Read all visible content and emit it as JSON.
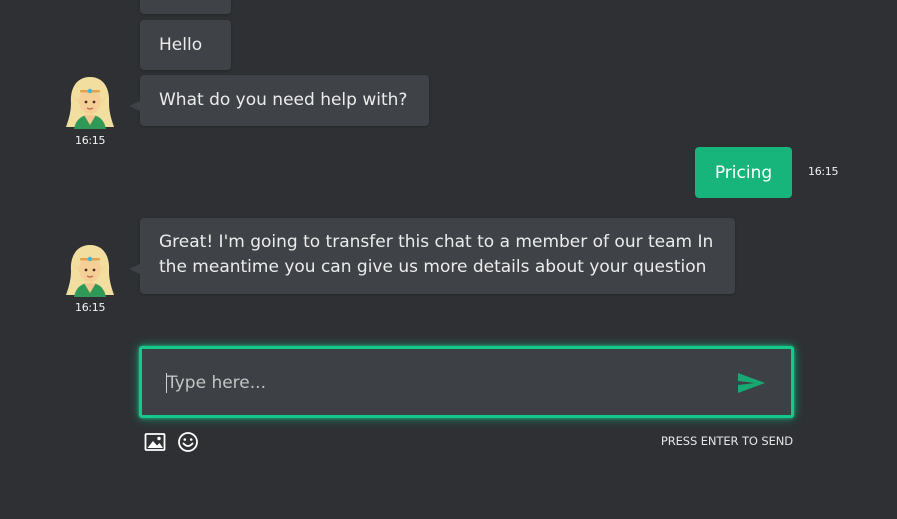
{
  "messages": [
    {
      "sender": "bot",
      "text": "Hello"
    },
    {
      "sender": "bot",
      "text": "What do you need help with?",
      "time": "16:15"
    },
    {
      "sender": "user",
      "text": "Pricing",
      "time": "16:15"
    },
    {
      "sender": "bot",
      "text": "Great! I'm going to transfer this chat to a member of our team In the meantime you can give us more details about your question",
      "time": "16:15"
    }
  ],
  "composer": {
    "placeholder": "Type here...",
    "hint": "PRESS ENTER TO SEND"
  },
  "icons": {
    "avatar": "elf-avatar-icon",
    "send": "send-icon",
    "image": "image-icon",
    "emoji": "smiley-icon"
  },
  "colors": {
    "background": "#2e3033",
    "bot_bubble": "#3f4246",
    "user_bubble": "#17b57c",
    "accent": "#15c98a"
  }
}
